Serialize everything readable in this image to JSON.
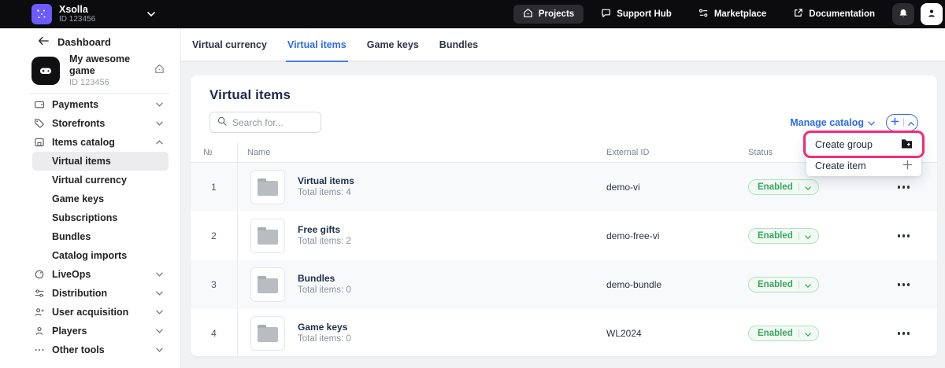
{
  "colors": {
    "accent_blue": "#2e6ce3",
    "annotation_pink": "#ee2d7d",
    "brand_purple": "#6e5bff",
    "status_green": "#3aa55c",
    "topbar_black": "#0c0c0e"
  },
  "topbar": {
    "brand_name": "Xsolla",
    "brand_id": "ID 123456",
    "nav": [
      {
        "label": "Projects",
        "icon": "home-icon"
      },
      {
        "label": "Support Hub",
        "icon": "chat-icon"
      },
      {
        "label": "Marketplace",
        "icon": "sliders-icon"
      },
      {
        "label": "Documentation",
        "icon": "external-link-icon"
      }
    ]
  },
  "sidebar": {
    "back_label": "Dashboard",
    "project_name": "My awesome game",
    "project_id": "ID 123456",
    "items_top": [
      {
        "label": "Payments",
        "icon": "wallet-icon"
      },
      {
        "label": "Storefronts",
        "icon": "tag-icon"
      },
      {
        "label": "Items catalog",
        "icon": "box-icon"
      }
    ],
    "catalog_subitems": [
      {
        "label": "Virtual items",
        "selected": true
      },
      {
        "label": "Virtual currency"
      },
      {
        "label": "Game keys"
      },
      {
        "label": "Subscriptions"
      },
      {
        "label": "Bundles"
      },
      {
        "label": "Catalog imports"
      }
    ],
    "items_bottom": [
      {
        "label": "LiveOps",
        "icon": "planet-icon"
      },
      {
        "label": "Distribution",
        "icon": "sliders-icon"
      },
      {
        "label": "User acquisition",
        "icon": "user-plus-icon"
      },
      {
        "label": "Players",
        "icon": "user-icon"
      },
      {
        "label": "Other tools",
        "icon": "ellipsis-icon"
      }
    ]
  },
  "tabs": [
    {
      "label": "Virtual currency"
    },
    {
      "label": "Virtual items",
      "active": true
    },
    {
      "label": "Game keys"
    },
    {
      "label": "Bundles"
    }
  ],
  "main": {
    "title": "Virtual items",
    "search_placeholder": "Search for...",
    "manage_catalog_label": "Manage catalog",
    "create_menu": [
      {
        "label": "Create group",
        "icon": "folder-plus-icon",
        "highlighted": true
      },
      {
        "label": "Create item",
        "icon": "plus-icon"
      }
    ],
    "table": {
      "col_num": "№",
      "col_name": "Name",
      "col_external_id": "External ID",
      "col_status": "Status",
      "rows": [
        {
          "num": "1",
          "name": "Virtual items",
          "subtitle": "Total items: 4",
          "external_id": "demo-vi",
          "status": "Enabled"
        },
        {
          "num": "2",
          "name": "Free gifts",
          "subtitle": "Total items: 2",
          "external_id": "demo-free-vi",
          "status": "Enabled"
        },
        {
          "num": "3",
          "name": "Bundles",
          "subtitle": "Total items: 0",
          "external_id": "demo-bundle",
          "status": "Enabled"
        },
        {
          "num": "4",
          "name": "Game keys",
          "subtitle": "Total items: 0",
          "external_id": "WL2024",
          "status": "Enabled"
        }
      ]
    }
  }
}
